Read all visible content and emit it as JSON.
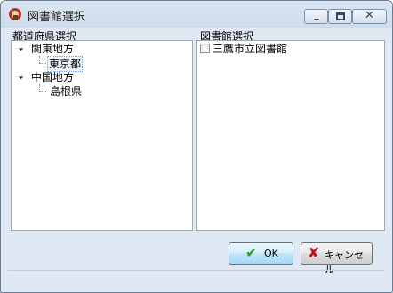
{
  "window": {
    "title": "図書館選択"
  },
  "prefecture_panel": {
    "label": "都道府県選択",
    "tree": [
      {
        "label": "関東地方",
        "expanded": true,
        "children": [
          {
            "label": "東京都",
            "selected": true
          }
        ]
      },
      {
        "label": "中国地方",
        "expanded": true,
        "children": [
          {
            "label": "島根県",
            "selected": false
          }
        ]
      }
    ]
  },
  "library_panel": {
    "label": "図書館選択",
    "items": [
      {
        "label": "三鷹市立図書館",
        "checked": false
      }
    ]
  },
  "buttons": {
    "ok_label": "OK",
    "cancel_label": "キャンセル"
  },
  "icons": {
    "ok": "check-icon",
    "cancel": "x-icon",
    "app": "library-app-icon"
  },
  "colors": {
    "ok_check": "#2e9e1f",
    "cancel_x": "#c0141b"
  }
}
